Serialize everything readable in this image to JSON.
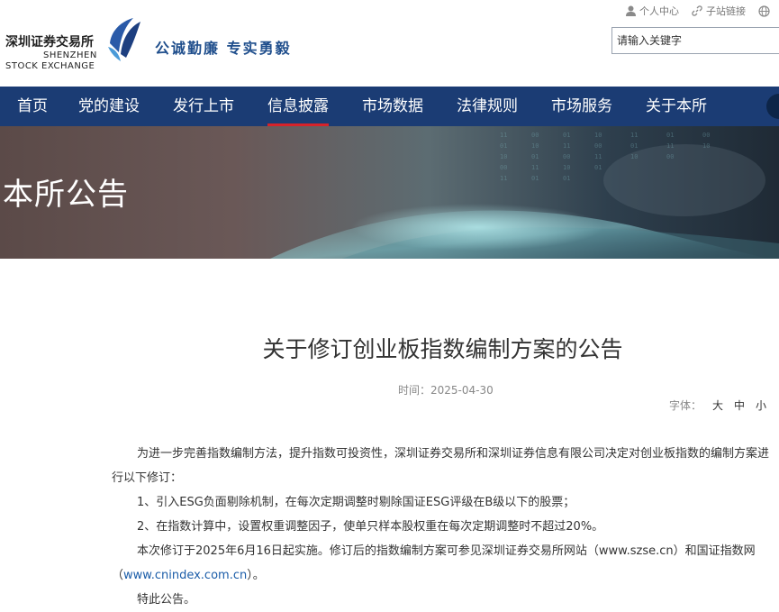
{
  "header": {
    "logo_cn": "深圳证券交易所",
    "logo_en_line1": "SHENZHEN",
    "logo_en_line2": "STOCK EXCHANGE",
    "slogan": "公诚勤廉  专实勇毅",
    "toplinks": [
      {
        "label": "个人中心",
        "icon": "user-icon"
      },
      {
        "label": "子站链接",
        "icon": "link-icon"
      },
      {
        "icon": "globe-icon"
      }
    ],
    "search_placeholder": "请输入关键字"
  },
  "nav": {
    "items": [
      "首页",
      "党的建设",
      "发行上市",
      "信息披露",
      "市场数据",
      "法律规则",
      "市场服务",
      "关于本所"
    ],
    "active": "信息披露"
  },
  "banner": {
    "title": "本所公告"
  },
  "article": {
    "title": "关于修订创业板指数编制方案的公告",
    "date": "时间：2025-04-30",
    "font_size_label": "字体：",
    "font_sizes": [
      "大",
      "中",
      "小"
    ],
    "paragraphs": [
      "为进一步完善指数编制方法，提升指数可投资性，深圳证券交易所和深圳证券信息有限公司决定对创业板指数的编制方案进行以下修订：",
      "1、引入ESG负面剔除机制，在每次定期调整时剔除国证ESG评级在B级以下的股票；",
      "2、在指数计算中，设置权重调整因子，使单只样本股权重在每次定期调整时不超过20%。",
      "本次修订于2025年6月16日起实施。修订后的指数编制方案可参见深圳证券交易所网站（www.szse.cn）和国证指数网（",
      "www.cnindex.com.cn",
      "）。",
      "特此公告。"
    ]
  },
  "colors": {
    "nav_bg": "#1b3c74",
    "active_underline": "#d6232a",
    "slogan": "#1f4e8c",
    "link": "#1a5ca8"
  }
}
